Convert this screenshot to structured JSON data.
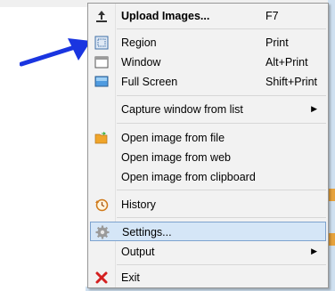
{
  "menu": {
    "items": [
      {
        "label": "Upload Images...",
        "shortcut": "F7",
        "icon": "upload-icon",
        "bold": true
      },
      {
        "label": "Region",
        "shortcut": "Print",
        "icon": "region-icon"
      },
      {
        "label": "Window",
        "shortcut": "Alt+Print",
        "icon": "window-icon"
      },
      {
        "label": "Full Screen",
        "shortcut": "Shift+Print",
        "icon": "fullscreen-icon"
      },
      {
        "label": "Capture window from list",
        "submenu": "▶"
      },
      {
        "label": "Open image from file",
        "icon": "folder-icon"
      },
      {
        "label": "Open image from web"
      },
      {
        "label": "Open image from clipboard"
      },
      {
        "label": "History",
        "icon": "history-icon"
      },
      {
        "label": "Settings...",
        "icon": "gear-icon",
        "highlighted": true
      },
      {
        "label": "Output",
        "submenu": "▶"
      },
      {
        "label": "Exit",
        "icon": "close-icon"
      }
    ]
  },
  "colors": {
    "highlight": "#d5e6f7",
    "highlight_border": "#7da2ce",
    "arrow": "#1a35e0"
  }
}
